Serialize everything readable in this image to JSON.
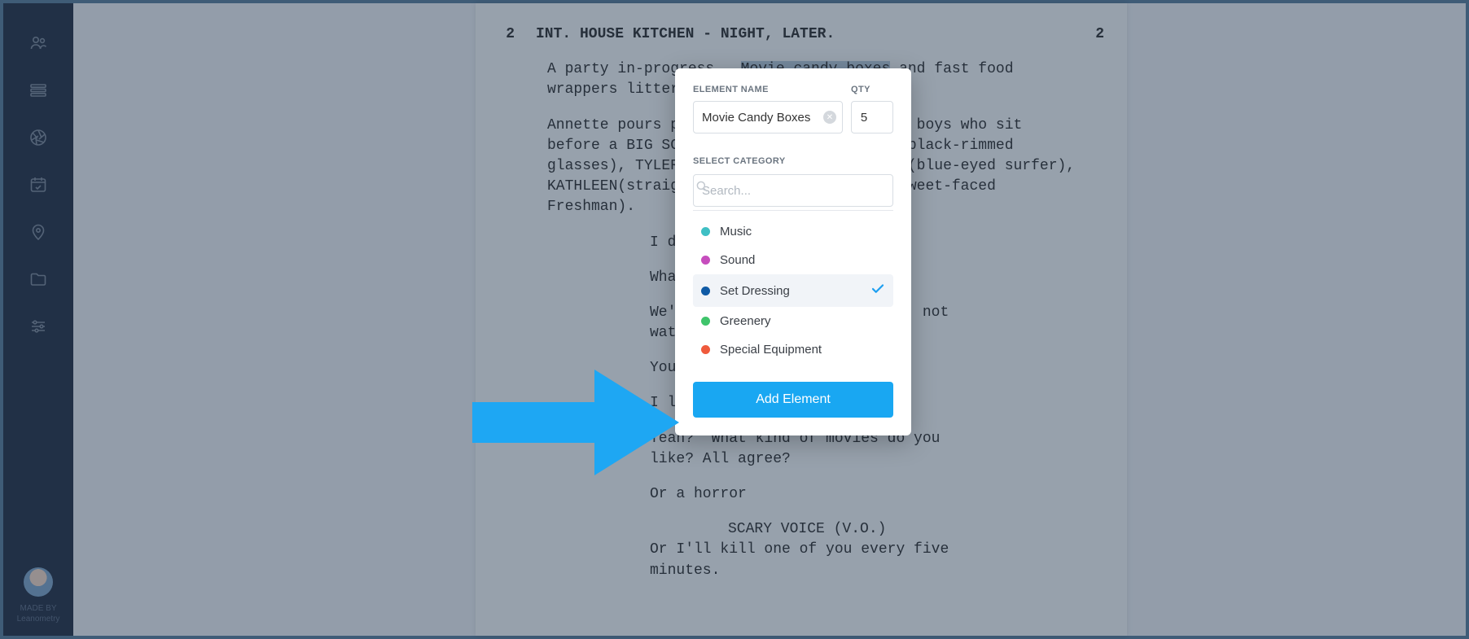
{
  "sidebar": {
    "icons": [
      "contacts-icon",
      "list-icon",
      "shutter-icon",
      "calendar-icon",
      "location-icon",
      "folder-icon",
      "settings-icon"
    ],
    "made_by_line1": "MADE BY",
    "made_by_line2": "Leanometry"
  },
  "script": {
    "scene_number": "2",
    "slugline": "INT. HOUSE KITCHEN - NIGHT, LATER.",
    "action1_pre": "A party in-progress.  ",
    "highlighted": "Movie candy boxes",
    "action1_post": " and fast food wrappers litter",
    "action2": "Annette pours popcorn into a bowl for the boys who sit before a BIG SCREEN TV.  They are: WILL (black-rimmed glasses), TYLER (letterman jacket), RYAN (blue-eyed surfer), KATHLEEN(straight outta Ohio) and TONY (sweet-faced Freshman).",
    "d1": "I don't know...",
    "d2": "What?",
    "d3": "We're supposed to be studying, not watching movies.",
    "d4": "You are such a girl.",
    "d5": "I like movies.",
    "d6": "Yeah?  What kind of movies do you like? All agree?",
    "d7": "Or a horror",
    "char_scary": "SCARY VOICE (V.O.)",
    "d8": "Or I'll kill one of you every five minutes."
  },
  "popup": {
    "label_name": "ELEMENT NAME",
    "label_qty": "QTY",
    "name_value": "Movie Candy Boxes",
    "qty_value": "5",
    "label_category": "SELECT CATEGORY",
    "search_placeholder": "Search...",
    "categories": [
      {
        "label": "Music",
        "color": "#3fbfc4",
        "selected": false
      },
      {
        "label": "Sound",
        "color": "#c64dbd",
        "selected": false
      },
      {
        "label": "Set Dressing",
        "color": "#0f5aa5",
        "selected": true
      },
      {
        "label": "Greenery",
        "color": "#3fc46b",
        "selected": false
      },
      {
        "label": "Special Equipment",
        "color": "#ef5a3c",
        "selected": false
      }
    ],
    "add_button": "Add Element"
  }
}
